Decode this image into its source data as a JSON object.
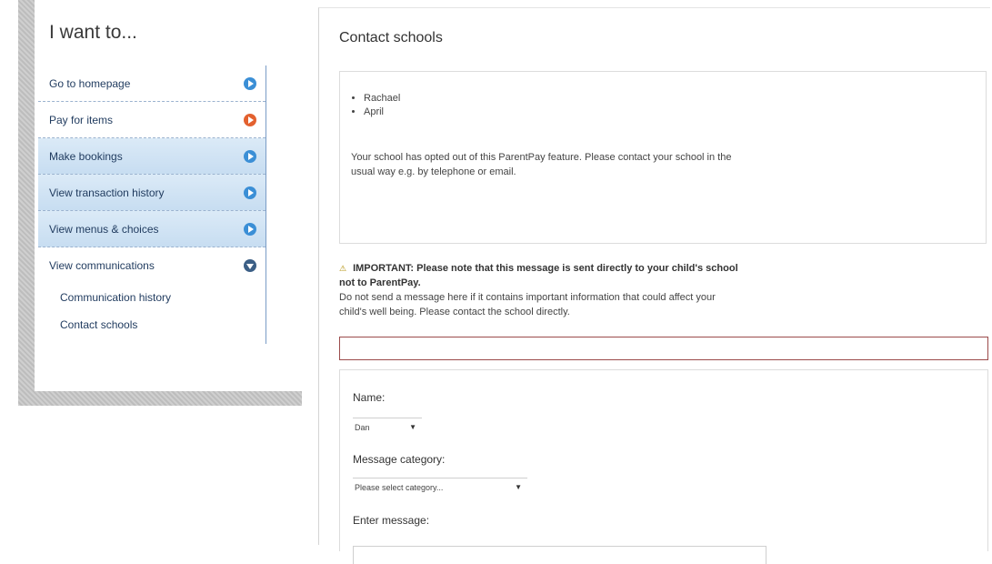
{
  "sidebar": {
    "title": "I want to...",
    "items": [
      {
        "label": "Go to homepage"
      },
      {
        "label": "Pay for items"
      },
      {
        "label": "Make bookings"
      },
      {
        "label": "View transaction history"
      },
      {
        "label": "View menus & choices"
      },
      {
        "label": "View communications"
      }
    ],
    "sub_items": [
      {
        "label": "Communication history"
      },
      {
        "label": "Contact schools"
      }
    ]
  },
  "main": {
    "title": "Contact schools",
    "children": [
      "Rachael",
      "April"
    ],
    "opted_out_message": "Your school has opted out of this ParentPay feature. Please contact your school in the usual way e.g. by telephone or email.",
    "warning": {
      "important": "IMPORTANT: Please note that this message is sent directly to your child's school not to ParentPay.",
      "line2": "Do not send a message here if it contains important information that could affect your child's well being. Please contact the school directly."
    },
    "form": {
      "name_label": "Name:",
      "name_value": "Dan",
      "category_label": "Message category:",
      "category_value": "Please select category...",
      "message_label": "Enter message:"
    }
  }
}
